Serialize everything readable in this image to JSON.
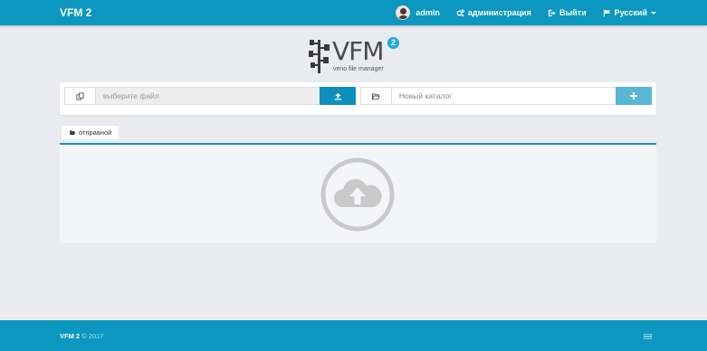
{
  "app": {
    "title": "VFM 2"
  },
  "navbar": {
    "user": "admin",
    "admin_label": "администрация",
    "logout_label": "Выйти",
    "language_label": "Русский"
  },
  "logo": {
    "text": "VFM",
    "badge": "2",
    "subtitle": "veno file manager"
  },
  "toolbar": {
    "upload_placeholder": "выберите файл",
    "new_folder_placeholder": "Новый каталог"
  },
  "breadcrumb": {
    "label": "отправной"
  },
  "footer": {
    "brand": "VFM 2",
    "year": "© 2017"
  },
  "colors": {
    "navbar": "#0b97c0",
    "upload_button": "#0e8fbd",
    "add_button": "#58b7d4",
    "accent_line": "#1d8fc0"
  },
  "icons": [
    "user-avatar",
    "cogs-icon",
    "logout-icon",
    "flag-icon",
    "copy-files-icon",
    "upload-icon",
    "folder-open-icon",
    "plus-icon",
    "cloud-upload-icon",
    "server-icon"
  ]
}
